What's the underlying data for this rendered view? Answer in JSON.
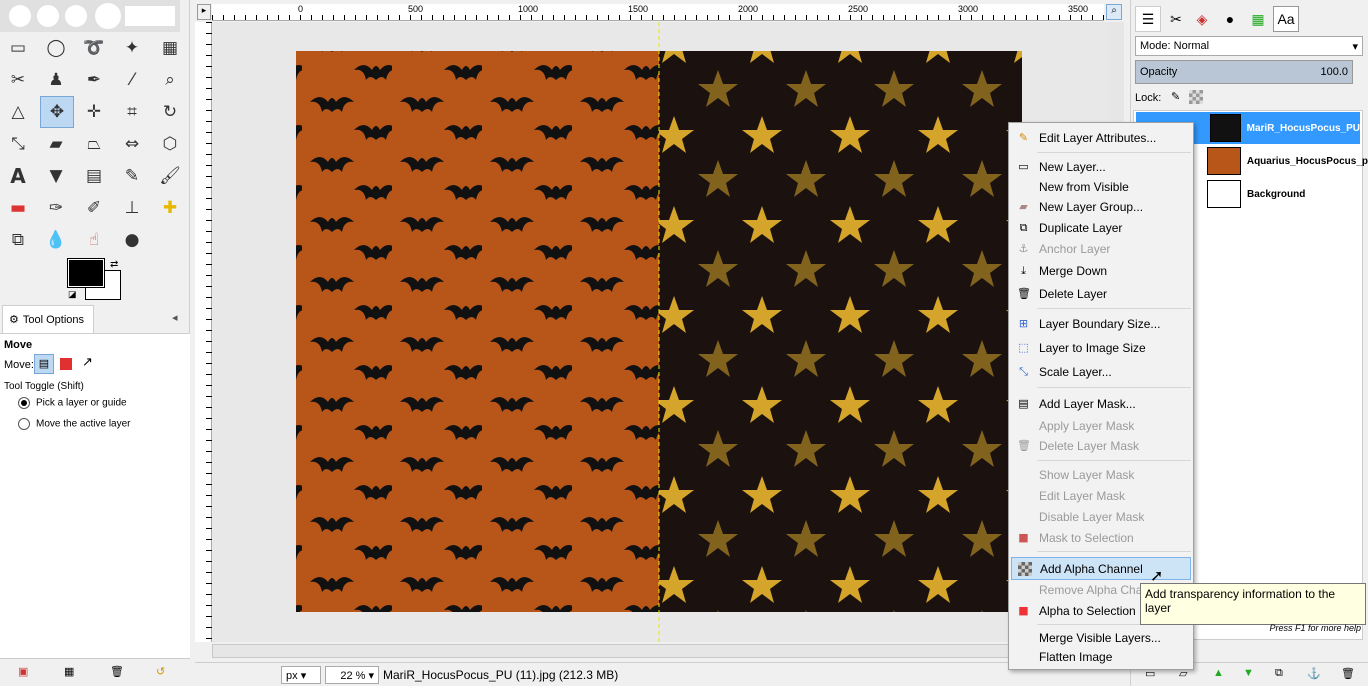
{
  "tool_options": {
    "tab_label": "Tool Options",
    "tool_name": "Move",
    "move_label": "Move:",
    "toggle_label": "Tool Toggle  (Shift)",
    "options": [
      "Pick a layer or guide",
      "Move the active layer"
    ],
    "selected_option": "Pick a layer or guide"
  },
  "ruler": {
    "top_ticks": [
      "0",
      "500",
      "1000",
      "1500",
      "2000",
      "2500",
      "3000",
      "3500"
    ]
  },
  "status_bar": {
    "unit": "px",
    "zoom": "22 %",
    "filename": "MariR_HocusPocus_PU (11).jpg (212.3 MB)"
  },
  "layers_panel": {
    "mode_label": "Mode: Normal",
    "opacity_label": "Opacity",
    "opacity_value": "100.0",
    "lock_label": "Lock:",
    "layers": [
      {
        "name": "MariR_HocusPocus_PU",
        "selected": true
      },
      {
        "name": "Aquarius_HocusPocus_p",
        "selected": false
      },
      {
        "name": "Background",
        "selected": false
      }
    ]
  },
  "context_menu": {
    "items": [
      {
        "label": "Edit Layer Attributes...",
        "enabled": true,
        "icon": "edit-icon"
      },
      {
        "label": "New Layer...",
        "enabled": true,
        "icon": "new-layer-icon"
      },
      {
        "label": "New from Visible",
        "enabled": true,
        "icon": ""
      },
      {
        "label": "New Layer Group...",
        "enabled": true,
        "icon": "folder-icon"
      },
      {
        "label": "Duplicate Layer",
        "enabled": true,
        "icon": "duplicate-icon"
      },
      {
        "label": "Anchor Layer",
        "enabled": false,
        "icon": "anchor-icon"
      },
      {
        "label": "Merge Down",
        "enabled": true,
        "icon": "merge-down-icon"
      },
      {
        "label": "Delete Layer",
        "enabled": true,
        "icon": "trash-icon"
      },
      {
        "label": "Layer Boundary Size...",
        "enabled": true,
        "icon": "boundary-icon"
      },
      {
        "label": "Layer to Image Size",
        "enabled": true,
        "icon": "fit-icon"
      },
      {
        "label": "Scale Layer...",
        "enabled": true,
        "icon": "scale-icon"
      },
      {
        "label": "Add Layer Mask...",
        "enabled": true,
        "icon": "mask-icon"
      },
      {
        "label": "Apply Layer Mask",
        "enabled": false,
        "icon": ""
      },
      {
        "label": "Delete Layer Mask",
        "enabled": false,
        "icon": "trash-icon"
      },
      {
        "label": "Show Layer Mask",
        "enabled": false,
        "icon": ""
      },
      {
        "label": "Edit Layer Mask",
        "enabled": false,
        "icon": ""
      },
      {
        "label": "Disable Layer Mask",
        "enabled": false,
        "icon": ""
      },
      {
        "label": "Mask to Selection",
        "enabled": false,
        "icon": "selection-icon"
      },
      {
        "label": "Add Alpha Channel",
        "enabled": true,
        "icon": "alpha-icon",
        "highlighted": true
      },
      {
        "label": "Remove Alpha Cha",
        "enabled": false,
        "icon": ""
      },
      {
        "label": "Alpha to Selection",
        "enabled": true,
        "icon": "selection-icon"
      },
      {
        "label": "Merge Visible Layers...",
        "enabled": true,
        "icon": ""
      },
      {
        "label": "Flatten Image",
        "enabled": true,
        "icon": ""
      }
    ]
  },
  "tooltip": {
    "text": "Add transparency information to the layer",
    "hint": "Press F1 for more help"
  },
  "colors": {
    "accent": "#3399ff",
    "orange_paper": "#b8561a",
    "dark_paper": "#1b1210",
    "star": "#d4a52a"
  }
}
